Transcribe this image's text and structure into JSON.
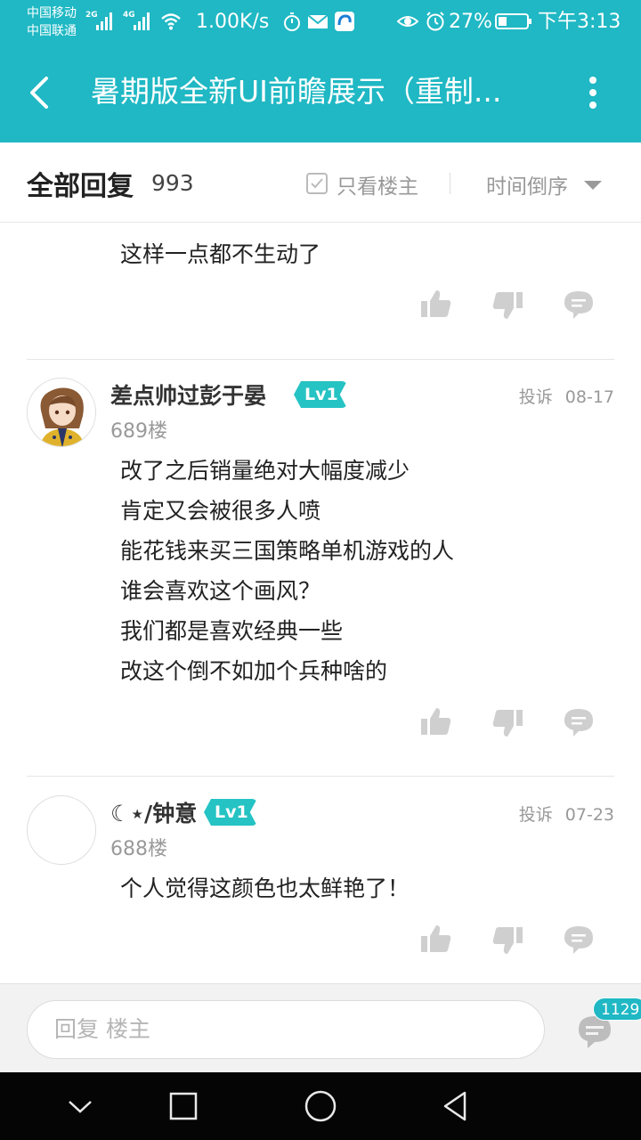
{
  "status_bar": {
    "carrier1": "中国移动",
    "carrier2": "中国联通",
    "net1": "2G",
    "net2": "4G",
    "speed": "1.00K/s",
    "battery": "27%",
    "time": "下午3:13"
  },
  "header": {
    "title": "暑期版全新UI前瞻展示（重制..."
  },
  "filter_bar": {
    "all_replies_label": "全部回复",
    "reply_count": "993",
    "only_op_label": "只看楼主",
    "sort_label": "时间倒序"
  },
  "partial_post": {
    "lines": [
      "这样一点都不生动了"
    ]
  },
  "posts": [
    {
      "username": "差点帅过彭于晏",
      "level": "Lv1",
      "floor": "689楼",
      "report": "投诉",
      "date": "08-17",
      "lines": [
        "改了之后销量绝对大幅度减少",
        "肯定又会被很多人喷",
        "能花钱来买三国策略单机游戏的人",
        "谁会喜欢这个画风？",
        "我们都是喜欢经典一些",
        "改这个倒不如加个兵种啥的"
      ]
    },
    {
      "username": "☾⋆/钟意",
      "level": "Lv1",
      "floor": "688楼",
      "report": "投诉",
      "date": "07-23",
      "lines": [
        "个人觉得这颜色也太鲜艳了！"
      ]
    }
  ],
  "reply_bar": {
    "placeholder": "回复  楼主",
    "badge_count": "1129"
  },
  "colors": {
    "accent": "#1fb8c4",
    "level_badge": "#25c3c3",
    "icon_gray": "#cfcfcf"
  }
}
